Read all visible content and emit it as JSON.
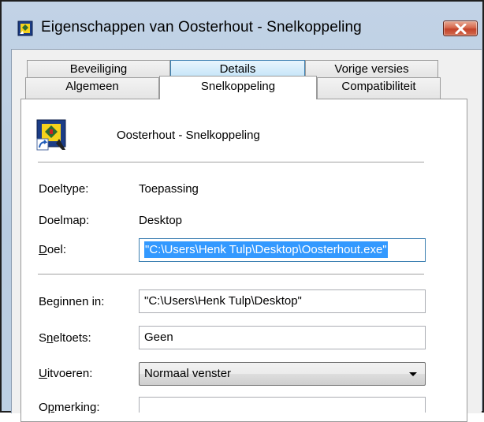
{
  "window": {
    "title": "Eigenschappen van Oosterhout - Snelkoppeling",
    "close_icon": "close-icon"
  },
  "tabs": {
    "row1": [
      {
        "label": "Beveiliging"
      },
      {
        "label": "Details"
      },
      {
        "label": "Vorige versies"
      }
    ],
    "row2": [
      {
        "label": "Algemeen"
      },
      {
        "label": "Snelkoppeling",
        "selected": true
      },
      {
        "label": "Compatibiliteit"
      }
    ]
  },
  "shortcut": {
    "name": "Oosterhout - Snelkoppeling",
    "icon": "application-shortcut-icon"
  },
  "info": {
    "doeltype_label": "Doeltype:",
    "doeltype_value": "Toepassing",
    "doelmap_label": "Doelmap:",
    "doelmap_value": "Desktop"
  },
  "doel": {
    "label_accel": "D",
    "label_rest": "oel:",
    "value": "\"C:\\Users\\Henk Tulp\\Desktop\\Oosterhout.exe\""
  },
  "beginnen": {
    "label_pre": "Be",
    "label_accel": "g",
    "label_rest": "innen in:",
    "value": "\"C:\\Users\\Henk Tulp\\Desktop\""
  },
  "sneltoets": {
    "label_pre": "S",
    "label_accel": "n",
    "label_rest": "eltoets:",
    "value": "Geen"
  },
  "uitvoeren": {
    "label_accel": "U",
    "label_rest": "itvoeren:",
    "value": "Normaal venster"
  },
  "opmerking": {
    "label_pre": "O",
    "label_accel": "p",
    "label_rest": "merking:"
  },
  "colors": {
    "selection": "#3399ff",
    "titlebar": "#b8cbe0",
    "close_button": "#c3432a"
  }
}
